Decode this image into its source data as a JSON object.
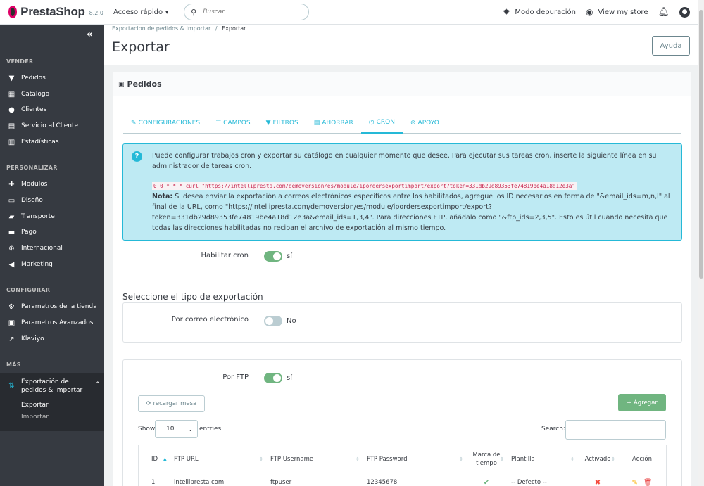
{
  "header": {
    "brand": "PrestaShop",
    "version": "8.2.0",
    "quick_access": "Acceso rápido",
    "search_placeholder": "Buscar",
    "debug_mode": "Modo depuración",
    "view_store": "View my store"
  },
  "sidebar": {
    "sections": {
      "vender": "VENDER",
      "personalizar": "PERSONALIZAR",
      "configurar": "CONFIGURAR",
      "mas": "MÁS"
    },
    "items": {
      "pedidos": "Pedidos",
      "catalogo": "Catalogo",
      "clientes": "Clientes",
      "servicio": "Servicio al Cliente",
      "estadisticas": "Estadísticas",
      "modulos": "Modulos",
      "diseno": "Diseño",
      "transporte": "Transporte",
      "pago": "Pago",
      "internacional": "Internacional",
      "marketing": "Marketing",
      "parametros_tienda": "Parametros de la tienda",
      "parametros_avanzados": "Parametros Avanzados",
      "klaviyo": "Klaviyo",
      "exportacion": "Exportación de pedidos & Importar",
      "exportar": "Exportar",
      "importar": "Importar"
    }
  },
  "page": {
    "breadcrumb_parent": "Exportacion de pedidos & Importar",
    "breadcrumb_sep": "/",
    "breadcrumb_current": "Exportar",
    "title": "Exportar",
    "help_button": "Ayuda"
  },
  "panel": {
    "title": "Pedidos",
    "tabs": {
      "config": "CONFIGURACIONES",
      "campos": "CAMPOS",
      "filtros": "FILTROS",
      "ahorrar": "AHORRAR",
      "cron": "CRON",
      "apoyo": "APOYO"
    },
    "alert": {
      "intro": "Puede configurar trabajos cron y exportar su catálogo en cualquier momento que desee. Para ejecutar sus tareas cron, inserte la siguiente línea en su administrador de tareas cron.",
      "command": "0 0 * * * curl \"https://intellipresta.com/demoversion/es/module/ipordersexportimport/export?token=331db29d89353fe74819be4a18d12e3a\"",
      "note_label": "Nota:",
      "note_text": " Si desea enviar la exportación a correos electrónicos específicos entre los habilitados, agregue los ID necesarios en forma de \"&email_ids=m,n,l\" al final de la URL, como \"https://intellipresta.com/demoversion/es/module/ipordersexportimport/export?token=331db29d89353fe74819be4a18d12e3a&email_ids=1,3,4\". Para direcciones FTP, añádalo como \"&ftp_ids=2,3,5\". Esto es útil cuando necesita que todas las direcciones habilitadas no reciban el archivo de exportación al mismo tiempo."
    },
    "enable_cron_label": "Habilitar cron",
    "enable_cron_value": "sí",
    "export_type_title": "Seleccione el tipo de exportación",
    "email_label": "Por correo electrónico",
    "email_value": "No",
    "ftp_label": "Por FTP",
    "ftp_value": "sí",
    "reload_button": "recargar mesa",
    "add_button": "Agregar",
    "show_label": "Show",
    "show_value": "10",
    "entries_label": "entries",
    "search_label": "Search:",
    "table": {
      "headers": {
        "id": "ID",
        "url": "FTP URL",
        "username": "FTP Username",
        "password": "FTP Password",
        "timestamp": "Marca de tiempo",
        "template": "Plantilla",
        "active": "Activado",
        "action": "Acción"
      },
      "rows": [
        {
          "id": "1",
          "url": "intellipresta.com",
          "username": "ftpuser",
          "password": "12345678",
          "template": "-- Defecto --"
        }
      ]
    }
  },
  "colors": {
    "accent": "#25b9d7",
    "sidebar": "#363a41",
    "success": "#70b580",
    "danger": "#f54c3e"
  }
}
